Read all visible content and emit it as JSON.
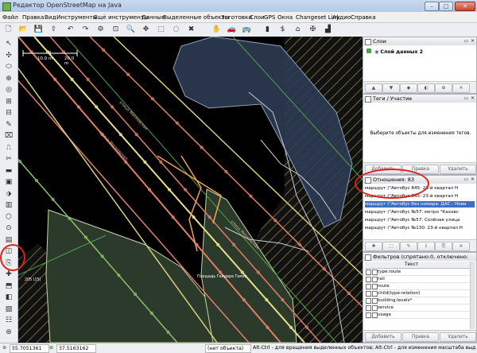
{
  "window": {
    "title": "Редактор OpenStreetMap на Java",
    "controls": [
      "–",
      "□",
      "✕"
    ]
  },
  "menu": {
    "items": [
      "Файл",
      "Правка",
      "Вид",
      "Инструменты",
      "Ещё инструменты",
      "Данные",
      "Выделенные объекты",
      "Заготовки",
      "Слои",
      "GPS",
      "Окна",
      "Changeset Link",
      "Аудио",
      "Справка"
    ]
  },
  "toolbar": {
    "icons": [
      "new-file-icon",
      "open-file-icon",
      "save-icon",
      "upload-icon",
      "undo-icon",
      "redo-icon",
      "preferences-icon",
      "zoom-fit-icon",
      "search-icon",
      "move-icon",
      "select-icon",
      "lasso-icon",
      "delete-icon",
      "hand-icon",
      "car-icon",
      "bus-icon",
      "shop-icon",
      "bank-icon",
      "building-icon",
      "crossing-icon",
      "factory-icon"
    ],
    "glyphs": [
      "🗋",
      "📂",
      "💾",
      "⇪",
      "↶",
      "↷",
      "⚙",
      "⊡",
      "🔍",
      "✥",
      "⬚",
      "◌",
      "✖",
      "✋",
      "🚗",
      "🚌",
      "▮",
      "$",
      "⌂",
      "✠",
      "▟"
    ]
  },
  "left_toolbar": {
    "glyphs": [
      "↖",
      "✣",
      "⬭",
      "⊕",
      "◎",
      "⊞",
      "⊟",
      "✎",
      "⌧",
      "⎍",
      "✂",
      "▬",
      "▣",
      "⬗",
      "▥",
      "⬡",
      "⊙",
      "▤",
      "◫",
      "⎘",
      "✚",
      "⬒",
      "◧",
      "▨",
      "☷",
      "⊛"
    ]
  },
  "map": {
    "scale_left": "10.0 m",
    "scale_right": "20.0 m",
    "labels": [
      "Площадь Гейдара Гамзе",
      "205 (15)"
    ],
    "road_label": "улица Московская"
  },
  "layers_panel": {
    "title": "Слои",
    "layer_name": "Слой данных 2"
  },
  "tags_panel": {
    "title": "Теги / Участие",
    "hint": "Выберите объекты для изменения тегов.",
    "buttons": [
      "Добавить",
      "Правка",
      "Удалить"
    ]
  },
  "relations_panel": {
    "title": "Отношения: 83",
    "items": [
      "маршрут (\"Автобус 845: 23-й квартал Н",
      "маршрут (\"Автобус 845: 23-й квартал Н",
      "маршрут (\"Автобус без номера: ДАС - Нови",
      "маршрут (\"Автобус №57: метро \"Каховс",
      "маршрут (\"Автобус №57: Солёная улица",
      "маршрут (\"Автобус №130: 23-й квартал Н"
    ],
    "selected_index": 2
  },
  "filter_panel": {
    "title": "Фильтров (спрятано:0, отключено:",
    "column_header": "Текст",
    "rows": [
      "type:route",
      "rail",
      "route",
      "child(type:relation)",
      "building:levels*",
      "service",
      "usage"
    ],
    "buttons": [
      "Добавить",
      "Правка",
      "Удалить"
    ]
  },
  "status": {
    "lat": "55.7051361",
    "lon": "37.5163162",
    "object": "(нет объекта)",
    "help": "Alt-Ctrl - для вращения выделенных объектов; Alt-Ctrl - для изменения масштаба выделенных объектов"
  }
}
